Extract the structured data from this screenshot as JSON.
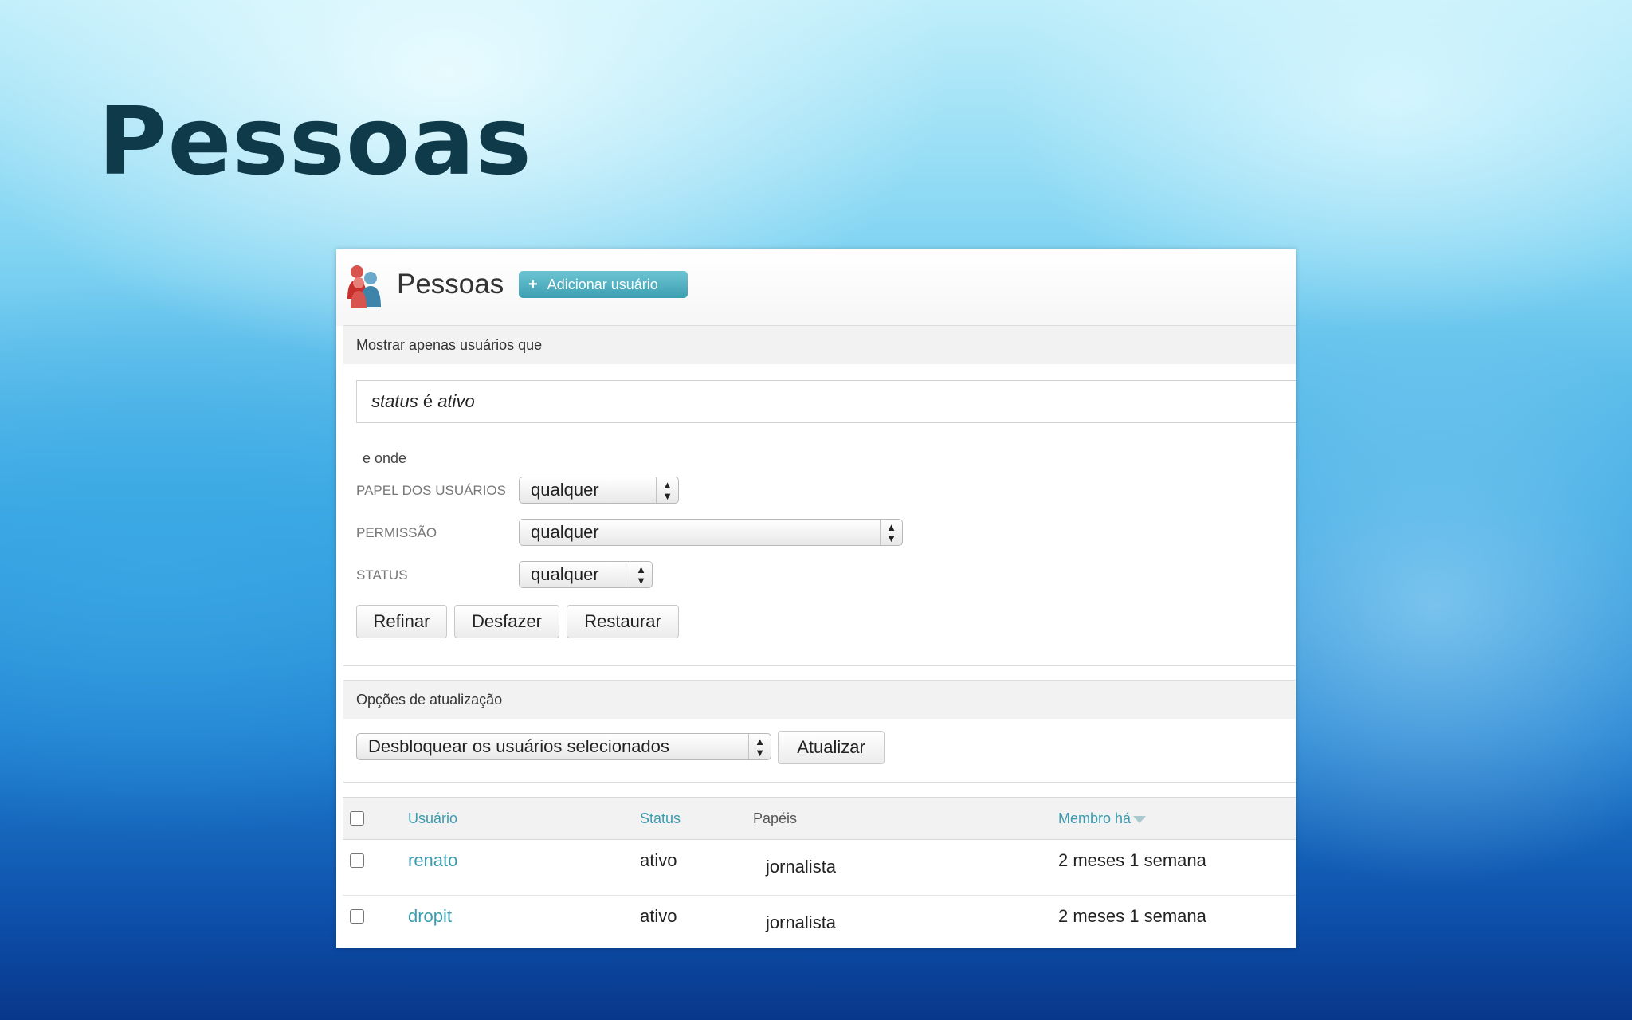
{
  "slide": {
    "title": "Pessoas"
  },
  "panel": {
    "title": "Pessoas",
    "add_user_label": "Adicionar usuário",
    "icon": "people-icon"
  },
  "filters": {
    "heading": "Mostrar apenas usuários que",
    "condition_field": "status",
    "condition_op": "é",
    "condition_value": "ativo",
    "and_where": "e onde",
    "role_label": "PAPEL DOS USUÁRIOS",
    "role_value": "qualquer",
    "permission_label": "PERMISSÃO",
    "permission_value": "qualquer",
    "status_label": "STATUS",
    "status_value": "qualquer",
    "refine_label": "Refinar",
    "undo_label": "Desfazer",
    "reset_label": "Restaurar"
  },
  "update": {
    "heading": "Opções de atualização",
    "action_value": "Desbloquear os usuários selecionados",
    "update_label": "Atualizar"
  },
  "table": {
    "columns": {
      "user": "Usuário",
      "status": "Status",
      "roles": "Papéis",
      "member_for": "Membro há"
    },
    "rows": [
      {
        "user": "renato",
        "status": "ativo",
        "roles": "jornalista",
        "member_for": "2 meses 1 semana"
      },
      {
        "user": "dropit",
        "status": "ativo",
        "roles": "jornalista",
        "member_for": "2 meses 1 semana"
      }
    ]
  },
  "colors": {
    "accent": "#3a9cb0",
    "title": "#0f3a4a"
  }
}
